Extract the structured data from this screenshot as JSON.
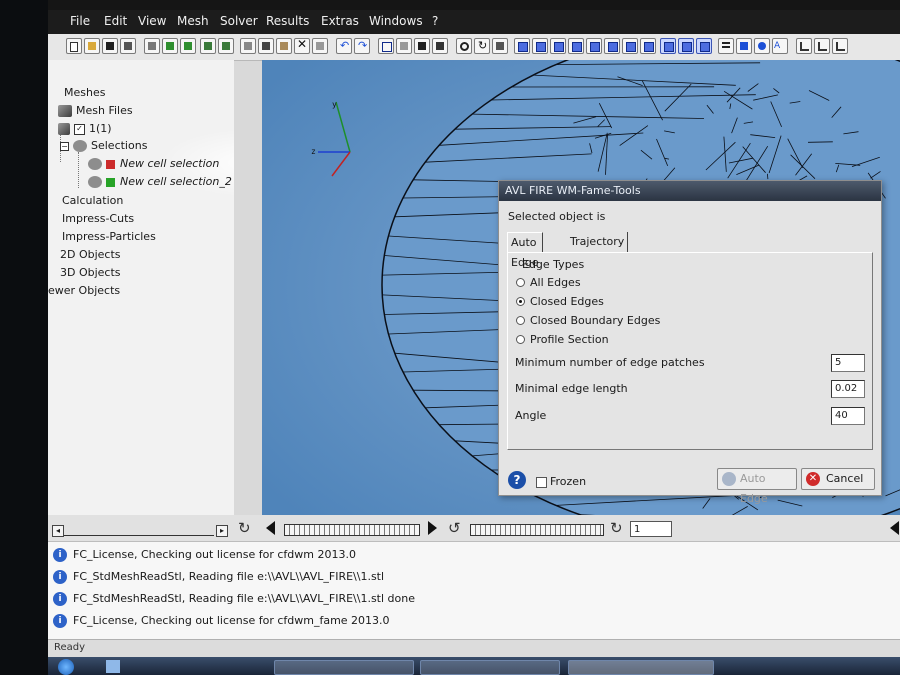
{
  "menu": [
    "File",
    "Edit",
    "View",
    "Mesh",
    "Solver",
    "Results",
    "Extras",
    "Windows",
    "?"
  ],
  "tree": {
    "meshes": "Meshes",
    "mesh_files": "Mesh Files",
    "mesh_1": "1(1)",
    "selections": "Selections",
    "selection_1": "New cell selection",
    "selection_2": "New cell selection_2",
    "calculation": "Calculation",
    "impress_cuts": "Impress-Cuts",
    "impress_particles": "Impress-Particles",
    "objects_2d": "2D Objects",
    "objects_3d": "3D Objects",
    "viewer_objects": "ewer Objects"
  },
  "colors": {
    "selection_1": "#cc2b2b",
    "selection_2": "#27a327",
    "viewport": "#5d90c2",
    "mesh_lines": "#0a0f18"
  },
  "axes": {
    "y": "y",
    "z": "z"
  },
  "dialog": {
    "title": "AVL FIRE WM-Fame-Tools",
    "selected_label": "Selected object is",
    "tabs": [
      "Auto Edge",
      "Trajectory"
    ],
    "group_label": "Edge Types",
    "options": [
      "All Edges",
      "Closed Edges",
      "Closed Boundary Edges",
      "Profile Section"
    ],
    "selected_option": "Closed Edges",
    "fields": [
      {
        "label": "Minimum number of edge patches",
        "value": "5"
      },
      {
        "label": "Minimal edge length",
        "value": "0.02"
      },
      {
        "label": "Angle",
        "value": "40"
      }
    ],
    "help": "?",
    "frozen_label": "Frozen",
    "auto_edge_button": "Auto Edge",
    "cancel_button": "Cancel"
  },
  "animation": {
    "frame_value": "1"
  },
  "log": [
    "FC_License, Checking out license for cfdwm 2013.0",
    "FC_StdMeshReadStl, Reading file e:\\\\AVL\\\\AVL_FIRE\\\\1.stl",
    "FC_StdMeshReadStl, Reading file e:\\\\AVL\\\\AVL_FIRE\\\\1.stl done",
    "FC_License, Checking out license for cfdwm_fame 2013.0"
  ],
  "status": "Ready"
}
